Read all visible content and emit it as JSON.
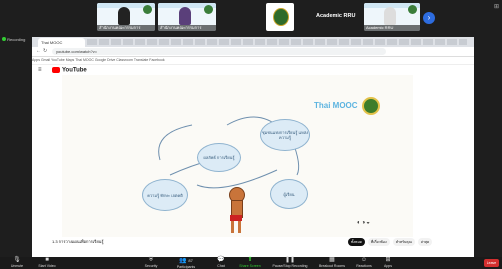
{
  "gallery": {
    "title": "Academic RRU",
    "participants": [
      {
        "name": "สำนักงานคณะกรรมการ"
      },
      {
        "name": "สำนักงานคณะกรรมการ"
      },
      {
        "name": ""
      },
      {
        "name": "Academic RRU"
      },
      {
        "name": "Academic RRU"
      }
    ]
  },
  "recording": "Recording",
  "browser": {
    "active_tab": "Thai MOOC",
    "url": "youtube.com/watch?v=",
    "bookmarks": "Apps  Gmail  YouTube  Maps  Thai MOOC  Google Drive  Classroom  Translate  Facebook",
    "yt_logo": "YouTube",
    "video_title": "1.3 การวางแผนเพื่อการเรียนรู้",
    "chips": [
      "ทั้งหมด",
      "ที่เกี่ยวข้อง",
      "สำหรับคุณ",
      "ล่าสุด"
    ]
  },
  "video": {
    "brand": "Thai MOOC",
    "bubbles": {
      "top_right": "ชุมชนแห่งการเรียนรู้ แหล่งความรู้",
      "center": "ผลลัพธ์ การเรียนรู้",
      "left": "ความรู้ ทักษะ เจตคติ",
      "right": "ผู้เรียน"
    },
    "controls": "◐◑◒"
  },
  "toolbar": {
    "items": [
      {
        "label": "Unmute",
        "icon": "🎙"
      },
      {
        "label": "Start Video",
        "icon": "■"
      },
      {
        "label": "Security",
        "icon": "⛨"
      },
      {
        "label": "Participants",
        "icon": "👥"
      },
      {
        "label": "Chat",
        "icon": "💬"
      },
      {
        "label": "Share Screen",
        "icon": "⬆"
      },
      {
        "label": "Pause/Stop Recording",
        "icon": "❚❚"
      },
      {
        "label": "Breakout Rooms",
        "icon": "▦"
      },
      {
        "label": "Reactions",
        "icon": "☺"
      },
      {
        "label": "Apps",
        "icon": "⊞"
      }
    ],
    "participant_count": "87",
    "leave": "Leave"
  }
}
